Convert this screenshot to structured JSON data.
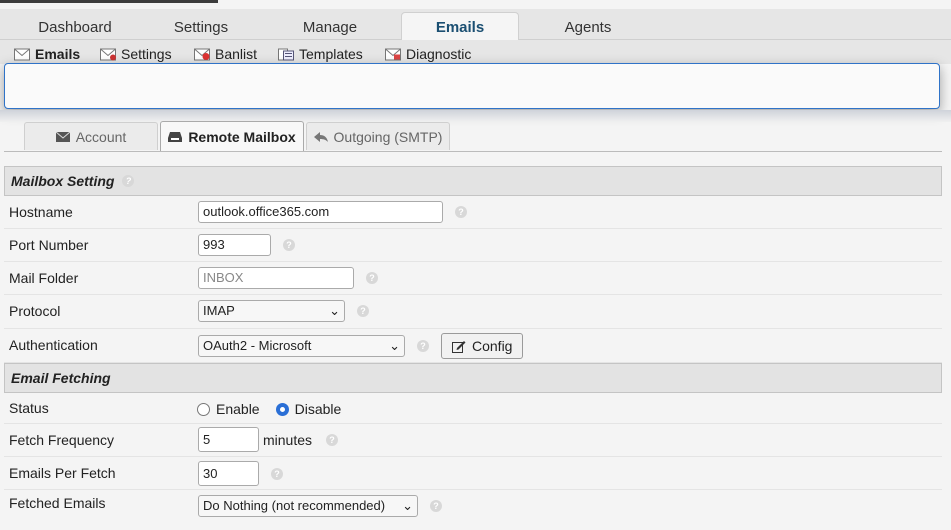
{
  "main_tabs": [
    {
      "label": "Dashboard"
    },
    {
      "label": "Settings"
    },
    {
      "label": "Manage"
    },
    {
      "label": "Emails"
    },
    {
      "label": "Agents"
    }
  ],
  "sub_tabs": [
    {
      "label": "Emails",
      "icon": "envelope-icon"
    },
    {
      "label": "Settings",
      "icon": "mail-settings-icon"
    },
    {
      "label": "Banlist",
      "icon": "banlist-icon"
    },
    {
      "label": "Templates",
      "icon": "templates-icon"
    },
    {
      "label": "Diagnostic",
      "icon": "diagnostic-icon"
    }
  ],
  "form_tabs": [
    {
      "label": "Account",
      "icon": "envelope-icon"
    },
    {
      "label": "Remote Mailbox",
      "icon": "inbox-icon"
    },
    {
      "label": "Outgoing (SMTP)",
      "icon": "reply-icon"
    }
  ],
  "sections": {
    "mailbox": "Mailbox Setting",
    "fetching": "Email Fetching"
  },
  "fields": {
    "hostname": {
      "label": "Hostname",
      "value": "outlook.office365.com"
    },
    "port": {
      "label": "Port Number",
      "value": "993"
    },
    "folder": {
      "label": "Mail Folder",
      "placeholder": "INBOX"
    },
    "protocol": {
      "label": "Protocol",
      "value": "IMAP"
    },
    "auth": {
      "label": "Authentication",
      "value": "OAuth2 - Microsoft",
      "config_label": "Config"
    },
    "status": {
      "label": "Status",
      "enable": "Enable",
      "disable": "Disable"
    },
    "frequency": {
      "label": "Fetch Frequency",
      "value": "5",
      "unit": "minutes"
    },
    "per_fetch": {
      "label": "Emails Per Fetch",
      "value": "30"
    },
    "fetched": {
      "label": "Fetched Emails",
      "value": "Do Nothing (not recommended)"
    }
  },
  "colors": {
    "accent": "#2f73c8",
    "active_tab_text": "#1b4f72"
  }
}
